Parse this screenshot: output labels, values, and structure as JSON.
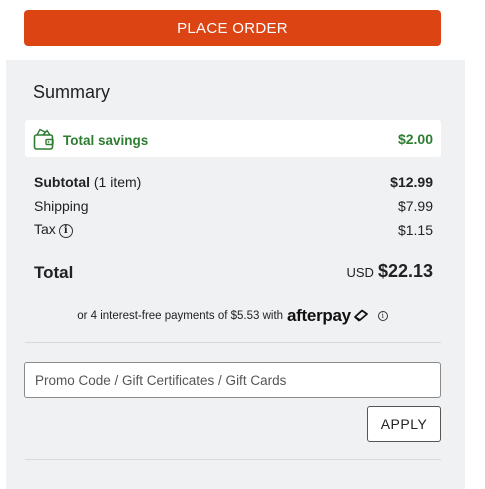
{
  "checkout": {
    "place_order_label": "PLACE ORDER"
  },
  "summary": {
    "title": "Summary",
    "savings": {
      "label": "Total savings",
      "value": "$2.00",
      "icon": "wallet-icon",
      "color": "#2e7d32"
    },
    "subtotal": {
      "label": "Subtotal",
      "count": "(1 item)",
      "value": "$12.99"
    },
    "shipping": {
      "label": "Shipping",
      "value": "$7.99"
    },
    "tax": {
      "label": "Tax",
      "value": "$1.15",
      "icon": "info-icon"
    },
    "total": {
      "label": "Total",
      "currency": "USD",
      "value": "$22.13"
    },
    "afterpay": {
      "text": "or 4 interest-free payments of $5.53 with",
      "brand": "afterpay",
      "info_icon": "info-icon"
    }
  },
  "promo": {
    "placeholder": "Promo Code / Gift Certificates / Gift Cards",
    "value": "",
    "apply_label": "APPLY"
  },
  "colors": {
    "primary": "#dd4414",
    "panel_bg": "#f0f1f3",
    "savings_green": "#2e7d32"
  }
}
